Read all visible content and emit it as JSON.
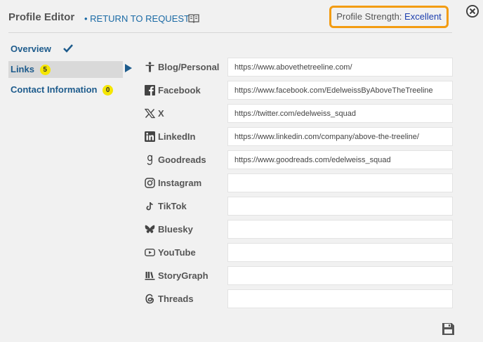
{
  "header": {
    "title": "Profile Editor",
    "return_link": "• RETURN TO REQUEST",
    "strength_label": "Profile Strength:",
    "strength_value": "Excellent"
  },
  "nav": {
    "items": [
      {
        "label": "Overview",
        "badge": ""
      },
      {
        "label": "Links",
        "badge": "5"
      },
      {
        "label": "Contact Information",
        "badge": "0"
      }
    ]
  },
  "links": [
    {
      "label": "Blog/Personal",
      "icon": "person-icon",
      "value": "https://www.abovethetreeline.com/"
    },
    {
      "label": "Facebook",
      "icon": "facebook-icon",
      "value": "https://www.facebook.com/EdelweissByAboveTheTreeline"
    },
    {
      "label": "X",
      "icon": "x-icon",
      "value": "https://twitter.com/edelweiss_squad"
    },
    {
      "label": "LinkedIn",
      "icon": "linkedin-icon",
      "value": "https://www.linkedin.com/company/above-the-treeline/"
    },
    {
      "label": "Goodreads",
      "icon": "goodreads-icon",
      "value": "https://www.goodreads.com/edelweiss_squad"
    },
    {
      "label": "Instagram",
      "icon": "instagram-icon",
      "value": ""
    },
    {
      "label": "TikTok",
      "icon": "tiktok-icon",
      "value": ""
    },
    {
      "label": "Bluesky",
      "icon": "bluesky-icon",
      "value": ""
    },
    {
      "label": "YouTube",
      "icon": "youtube-icon",
      "value": ""
    },
    {
      "label": "StoryGraph",
      "icon": "storygraph-icon",
      "value": ""
    },
    {
      "label": "Threads",
      "icon": "threads-icon",
      "value": ""
    }
  ],
  "colors": {
    "accent_orange": "#f39c12",
    "link_blue": "#1a6aa5",
    "nav_blue": "#1d5b8c",
    "badge_yellow": "#f5e600"
  }
}
